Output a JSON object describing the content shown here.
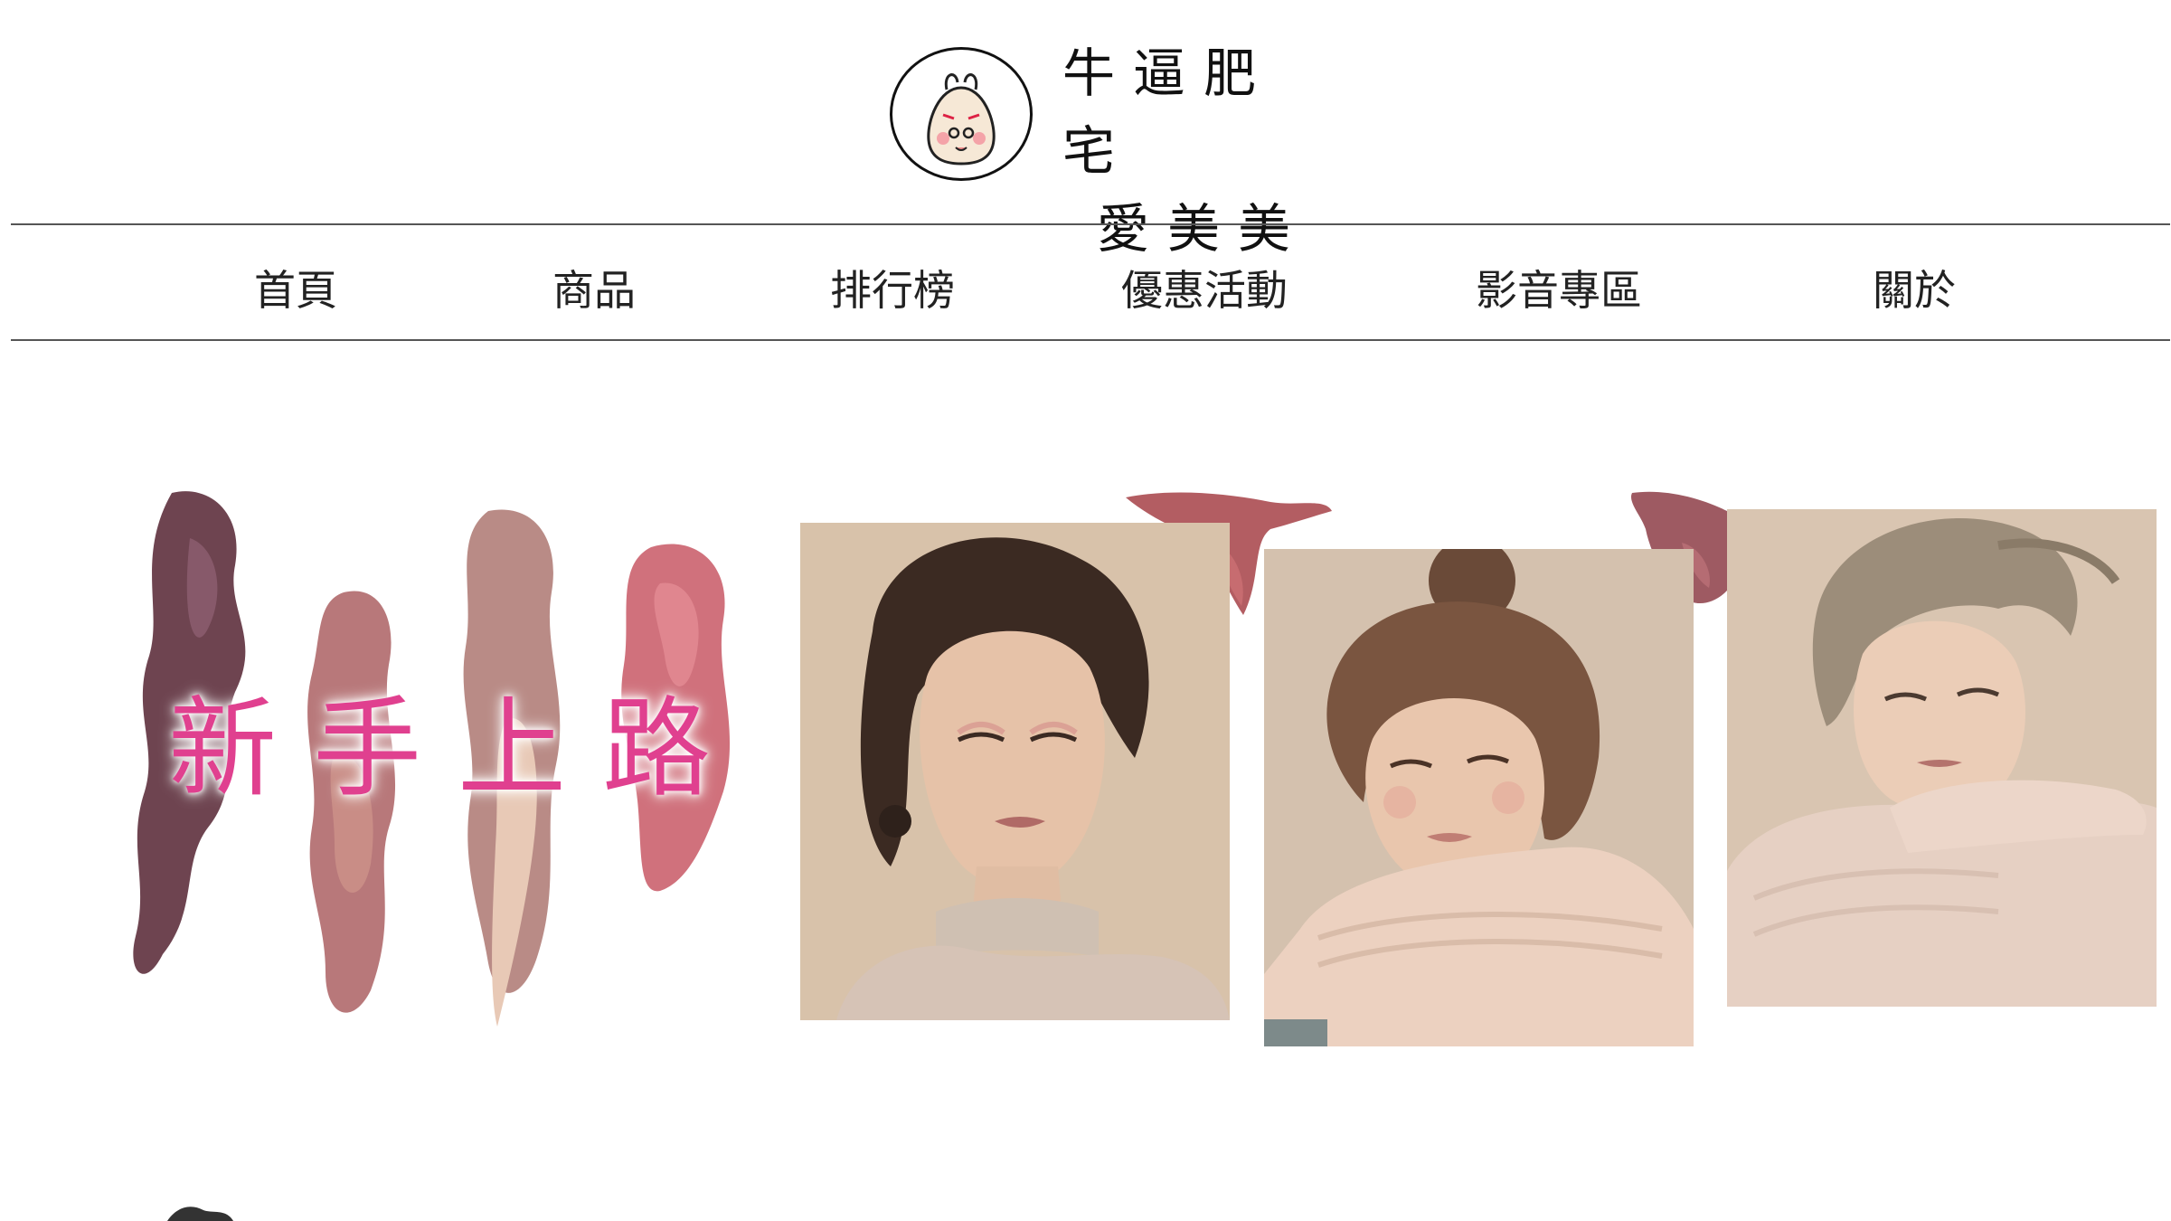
{
  "brand": {
    "name_line1": "牛逼肥宅",
    "name_line2": "愛美美",
    "logo_icon": "onigiri-mascot-icon"
  },
  "nav": {
    "items": [
      {
        "label": "首頁"
      },
      {
        "label": "商品"
      },
      {
        "label": "排行榜"
      },
      {
        "label": "優惠活動"
      },
      {
        "label": "影音專區"
      },
      {
        "label": "關於"
      }
    ]
  },
  "banner": {
    "title": "新手上路"
  },
  "colors": {
    "title_pink": "#e0408f",
    "background": "#ffffff",
    "divider": "#555555",
    "photo_bg": "#d9c4ad"
  }
}
